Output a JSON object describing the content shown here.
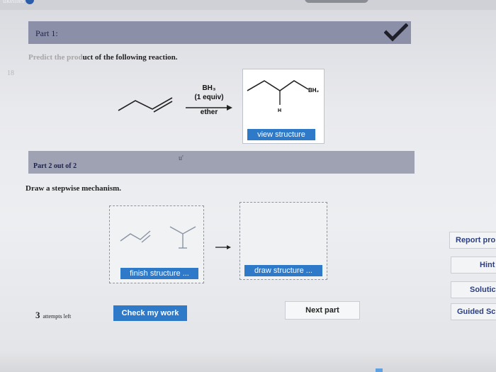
{
  "top": {
    "tab_label": "ukemes"
  },
  "part1": {
    "title": "Part 1:",
    "instruction_faded": "Predict the prod",
    "instruction_main": "uct of the following reaction.",
    "margin_mark": "18"
  },
  "reaction": {
    "reagent_line1": "BH₃",
    "reagent_line2": "(1 equiv)",
    "solvent": "ether",
    "product_label_bh2": "BH₂",
    "product_label_h": "H"
  },
  "buttons": {
    "view_structure": "view structure",
    "finish_structure": "finish structure ...",
    "draw_structure": "draw structure ...",
    "check_my_work": "Check my work",
    "next_part": "Next part"
  },
  "part2": {
    "title": "Part 2 out of 2",
    "tick_mark": "u'",
    "instruction": "Draw a stepwise mechanism."
  },
  "sidebar": {
    "report": "Report pro",
    "hint": "Hint",
    "solution": "Solutic",
    "guided": "Guided Sc"
  },
  "attempts": {
    "count": "3",
    "label": "attempts left"
  },
  "colors": {
    "accent_blue": "#2f79c9",
    "part_bar": "#8b8fa8",
    "check": "#1f1f2a"
  }
}
